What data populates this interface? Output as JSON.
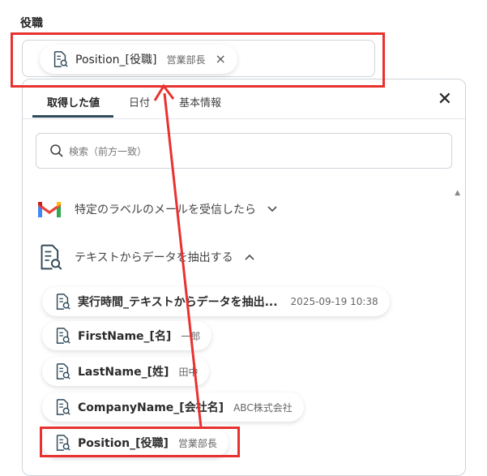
{
  "field": {
    "label": "役職",
    "token_name": "Position_[役職]",
    "token_value": "営業部長",
    "remove_icon": "×"
  },
  "panel": {
    "tabs": [
      {
        "label": "取得した値",
        "active": true
      },
      {
        "label": "日付",
        "active": false
      },
      {
        "label": "基本情報",
        "active": false
      }
    ],
    "close_icon": "✕",
    "search_placeholder": "検索（前方一致）",
    "sections": [
      {
        "label": "特定のラベルのメールを受信したら",
        "icon": "gmail-icon",
        "chevron": "⌄"
      },
      {
        "label": "テキストからデータを抽出する",
        "icon": "document-search-icon",
        "chevron": "⌃"
      }
    ],
    "items": [
      {
        "name": "実行時間_テキストからデータを抽出...",
        "value": "2025-09-19 10:38"
      },
      {
        "name": "FirstName_[名]",
        "value": "一郎"
      },
      {
        "name": "LastName_[姓]",
        "value": "田中"
      },
      {
        "name": "CompanyName_[会社名]",
        "value": "ABC株式会社"
      },
      {
        "name": "Position_[役職]",
        "value": "営業部長"
      }
    ]
  },
  "colors": {
    "highlight": "#e8322f",
    "tab_underline": "#2f4a5a",
    "gmail_red": "#ea4335",
    "doc_icon": "#2f4a5a"
  }
}
